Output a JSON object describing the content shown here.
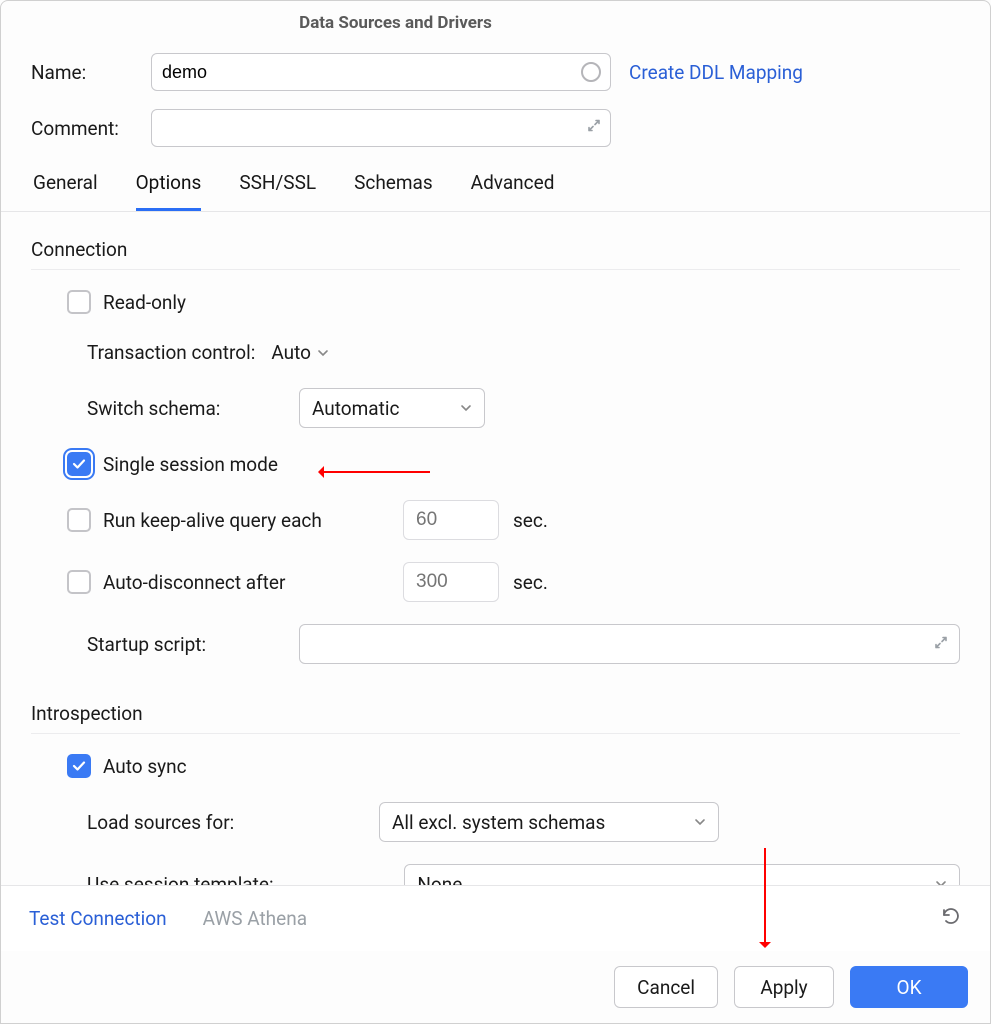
{
  "title": "Data Sources and Drivers",
  "header": {
    "name_label": "Name:",
    "name_value": "demo",
    "comment_label": "Comment:",
    "comment_value": "",
    "create_ddl_link": "Create DDL Mapping"
  },
  "tabs": [
    "General",
    "Options",
    "SSH/SSL",
    "Schemas",
    "Advanced"
  ],
  "active_tab": "Options",
  "connection": {
    "section": "Connection",
    "read_only": "Read-only",
    "tx_control_label": "Transaction control:",
    "tx_control_value": "Auto",
    "switch_schema_label": "Switch schema:",
    "switch_schema_value": "Automatic",
    "single_session": "Single session mode",
    "keepalive_label": "Run keep-alive query each",
    "keepalive_value": "60",
    "sec": "sec.",
    "autodis_label": "Auto-disconnect after",
    "autodis_value": "300",
    "startup_label": "Startup script:",
    "startup_value": ""
  },
  "introspection": {
    "section": "Introspection",
    "auto_sync": "Auto sync",
    "load_label": "Load sources for:",
    "load_value": "All excl. system schemas",
    "tpl_label": "Use session template:",
    "tpl_value": "None"
  },
  "footer": {
    "test_connection": "Test Connection",
    "driver": "AWS Athena"
  },
  "buttons": {
    "cancel": "Cancel",
    "apply": "Apply",
    "ok": "OK"
  }
}
